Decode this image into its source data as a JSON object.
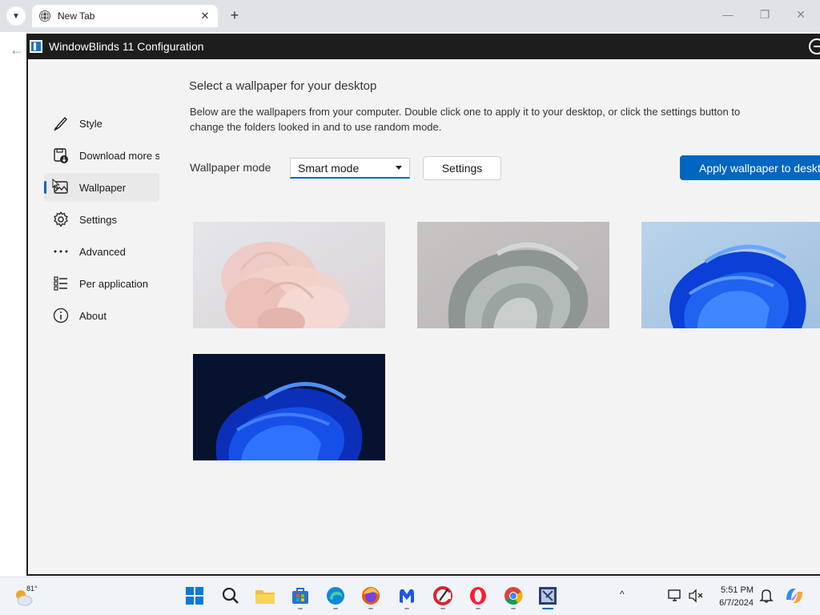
{
  "browser": {
    "tab_title": "New Tab",
    "tab_close": "✕",
    "new_tab": "+",
    "back": "←",
    "minimize": "—",
    "restore": "❐",
    "close": "✕"
  },
  "app": {
    "title": "WindowBlinds 11 Configuration"
  },
  "sidebar": {
    "items": [
      {
        "label": "Style",
        "icon": "brush-icon",
        "active": false
      },
      {
        "label": "Download more s",
        "icon": "download-icon",
        "active": false
      },
      {
        "label": "Wallpaper",
        "icon": "wallpaper-icon",
        "active": true
      },
      {
        "label": "Settings",
        "icon": "gear-icon",
        "active": false
      },
      {
        "label": "Advanced",
        "icon": "more-icon",
        "active": false
      },
      {
        "label": "Per application",
        "icon": "list-icon",
        "active": false
      },
      {
        "label": "About",
        "icon": "info-icon",
        "active": false
      }
    ]
  },
  "main": {
    "heading": "Select a wallpaper for your desktop",
    "description": "Below are the wallpapers from your computer.  Double click one to apply it to your desktop, or click the settings button to change the folders looked in and to use random mode.",
    "mode_label": "Wallpaper mode",
    "mode_value": "Smart mode",
    "settings_label": "Settings",
    "apply_label": "Apply wallpaper to desktop",
    "accent_color": "#0067c0",
    "wallpapers": [
      {
        "name": "bloom-pink"
      },
      {
        "name": "bloom-gray"
      },
      {
        "name": "bloom-blue-light"
      },
      {
        "name": "bloom-blue-dark"
      }
    ]
  },
  "taskbar": {
    "weather_temp": "81°",
    "time": "5:51 PM",
    "date": "6/7/2024",
    "tray_chevron": "^"
  }
}
